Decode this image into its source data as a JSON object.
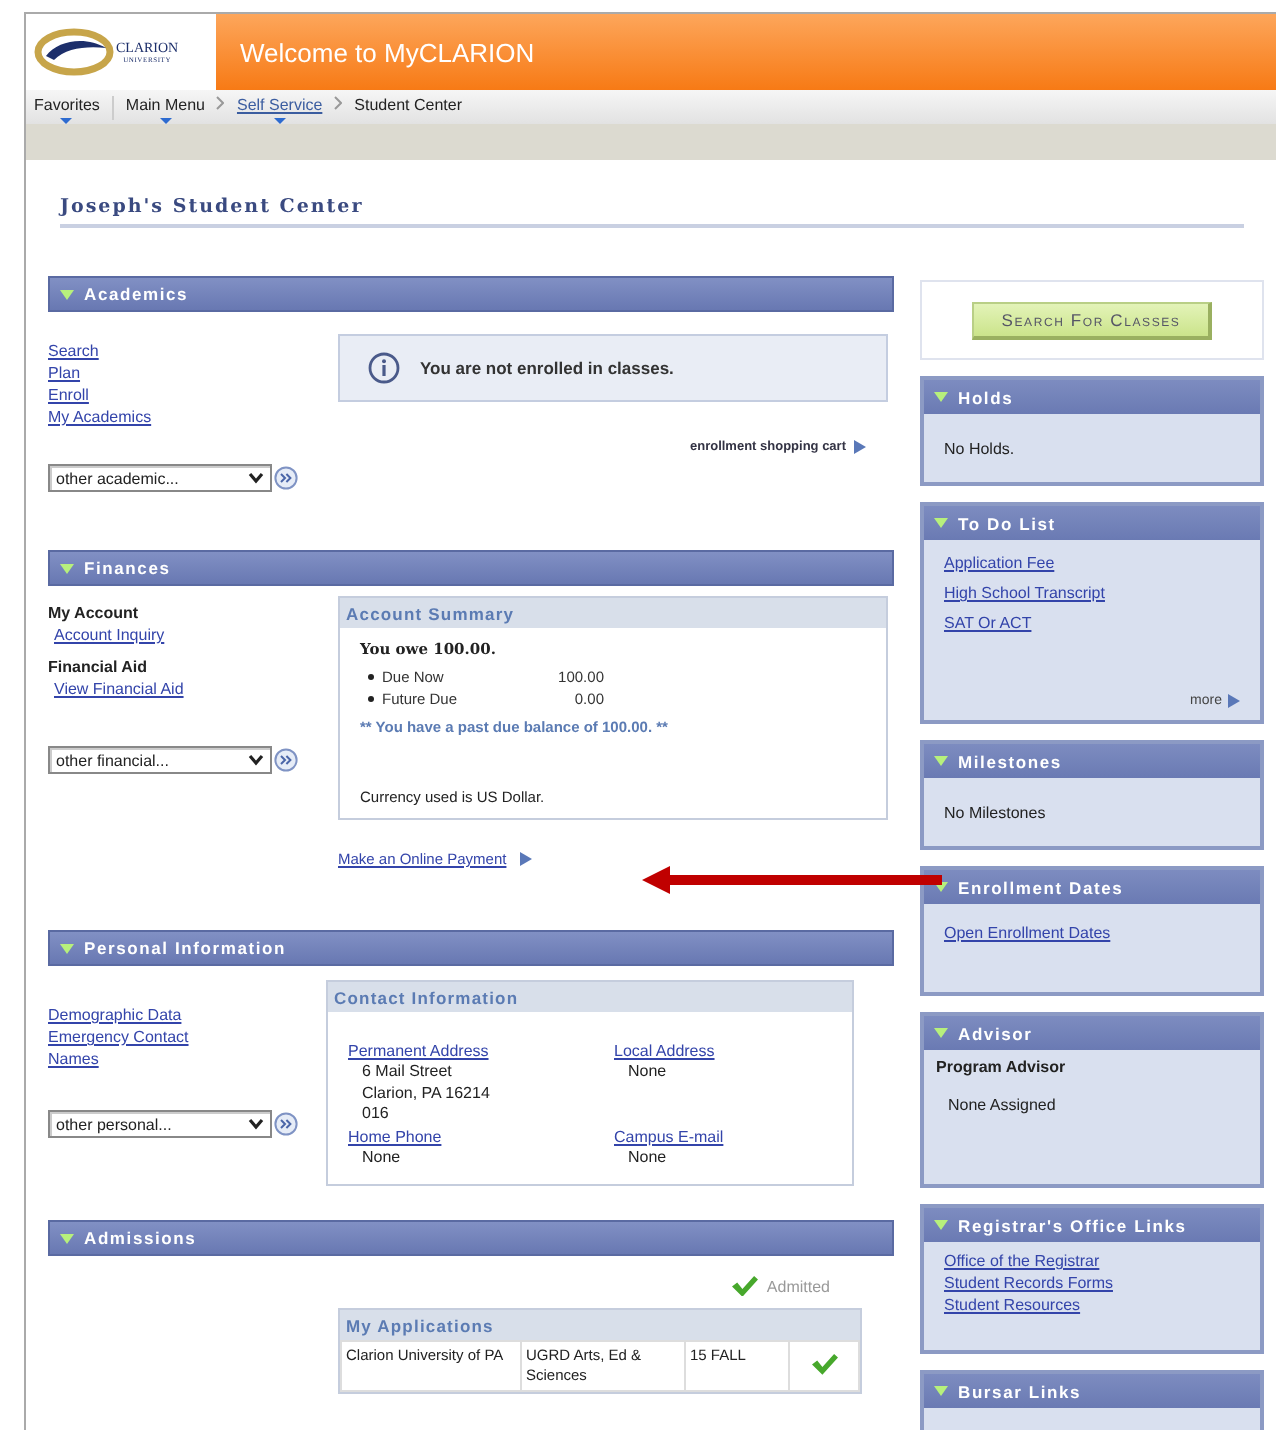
{
  "logo": {
    "name": "CLARION",
    "sub": "UNIVERSITY"
  },
  "banner_title": "Welcome to MyCLARION",
  "breadcrumbs": [
    {
      "label": "Favorites",
      "kind": "menu"
    },
    {
      "label": "Main Menu",
      "kind": "menu"
    },
    {
      "label": "Self Service",
      "kind": "link"
    },
    {
      "label": "Student Center",
      "kind": "page"
    }
  ],
  "page_title": "Joseph's Student Center",
  "sections": [
    {
      "kind": "academics",
      "title": "Academics",
      "links": [
        "Search",
        "Plan",
        "Enroll",
        "My Academics"
      ],
      "select": "other academic...",
      "notice": "You are not enrolled in classes.",
      "cart_link": "enrollment shopping cart"
    },
    {
      "kind": "finances",
      "title": "Finances",
      "groups": [
        {
          "heading": "My Account",
          "links": [
            "Account Inquiry"
          ]
        },
        {
          "heading": "Financial Aid",
          "links": [
            "View Financial Aid"
          ]
        }
      ],
      "select": "other financial...",
      "summary": {
        "title": "Account Summary",
        "owe": "You owe 100.00.",
        "items": [
          {
            "label": "Due Now",
            "amount": "100.00"
          },
          {
            "label": "Future Due",
            "amount": "0.00"
          }
        ],
        "alert": "** You have a past due balance of 100.00. **",
        "currency": "Currency used is US Dollar."
      },
      "payment_link": "Make an Online Payment"
    },
    {
      "kind": "personal",
      "title": "Personal Information",
      "links": [
        "Demographic Data",
        "Emergency Contact",
        "Names"
      ],
      "select": "other personal...",
      "contact": {
        "title": "Contact Information",
        "fields": [
          {
            "label": "Permanent Address",
            "lines": [
              "6 Mail Street",
              "Clarion, PA 16214",
              "016"
            ]
          },
          {
            "label": "Local Address",
            "lines": [
              "None"
            ]
          },
          {
            "label": "Home Phone",
            "lines": [
              "None"
            ]
          },
          {
            "label": "Campus E-mail",
            "lines": [
              "None"
            ]
          }
        ]
      }
    },
    {
      "kind": "admissions",
      "title": "Admissions",
      "status": "Admitted",
      "applications": {
        "title": "My Applications",
        "rows": [
          {
            "cells": [
              "Clarion University of PA",
              "UGRD Arts, Ed & Sciences",
              "15 FALL"
            ],
            "admitted": true
          }
        ]
      }
    }
  ],
  "search_button": "Search For Classes",
  "panels": [
    {
      "kind": "text",
      "title": "Holds",
      "text": "No Holds."
    },
    {
      "kind": "links",
      "title": "To Do List",
      "links": [
        "Application Fee",
        "High School Transcript",
        "SAT Or ACT"
      ],
      "more": "more"
    },
    {
      "kind": "text",
      "title": "Milestones",
      "text": "No Milestones"
    },
    {
      "kind": "links",
      "title": "Enrollment Dates",
      "links": [
        "Open Enrollment Dates"
      ]
    },
    {
      "kind": "advisor",
      "title": "Advisor",
      "heading": "Program Advisor",
      "text": "None Assigned"
    },
    {
      "kind": "links",
      "title": "Registrar's Office Links",
      "links": [
        "Office of the Registrar",
        "Student Records Forms",
        "Student Resources"
      ]
    },
    {
      "kind": "links",
      "title": "Bursar Links"
    }
  ]
}
